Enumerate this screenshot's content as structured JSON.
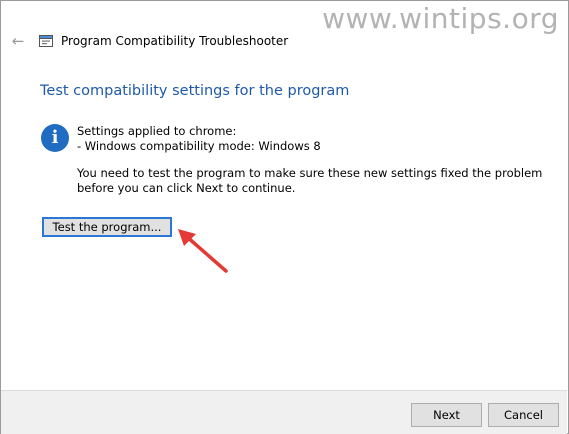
{
  "window": {
    "title": "Program Compatibility Troubleshooter",
    "back_icon": "back-arrow-icon",
    "app_icon": "troubleshooter-icon"
  },
  "watermark": "www.wintips.org",
  "heading": "Test compatibility settings for the program",
  "info": {
    "icon": "info-icon",
    "icon_glyph": "i",
    "line1": "Settings applied to chrome:",
    "line2": "- Windows compatibility mode: Windows 8",
    "message": "You need to test the program to make sure these new settings fixed the problem before you can click Next to continue."
  },
  "test_button": {
    "label": "Test the program..."
  },
  "annotation": {
    "arrow_color": "#e53935"
  },
  "footer": {
    "next_label": "Next",
    "cancel_label": "Cancel"
  },
  "colors": {
    "heading": "#1e5aa8",
    "accent": "#2a78d4"
  }
}
